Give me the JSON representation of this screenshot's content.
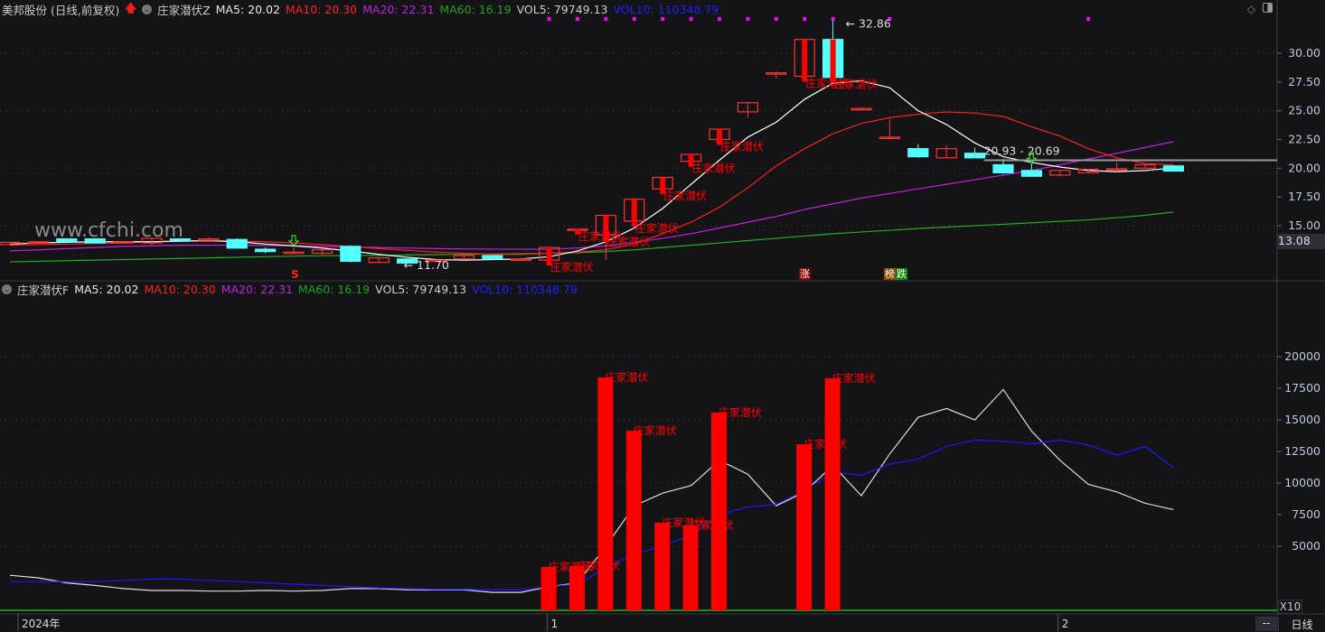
{
  "header": {
    "stock": "美邦股份 (日线,前复权)",
    "indicator": "庄家潜伏Z",
    "ma5": "MA5: 20.02",
    "ma10": "MA10: 20.30",
    "ma20": "MA20: 22.31",
    "ma60": "MA60: 16.19",
    "vol5": "VOL5: 79749.13",
    "vol10": "VOL10: 110348.79"
  },
  "header2": {
    "indicator": "庄家潜伏F",
    "ma5": "MA5: 20.02",
    "ma10": "MA10: 20.30",
    "ma20": "MA20: 22.31",
    "ma60": "MA60: 16.19",
    "vol5": "VOL5: 79749.13",
    "vol10": "VOL10: 110348.79"
  },
  "watermark": "www.cfchi.com",
  "current_price": "13.08",
  "scale_label": "X10",
  "period_label": "日线",
  "dash_label": "--",
  "badges": {
    "rise": "涨",
    "list": "榜",
    "fall": "跌"
  },
  "colors": {
    "up": "#ff3232",
    "down": "#54ffff",
    "signal": "#ff0000",
    "ma5": "#ffffff",
    "ma10": "#ff2020",
    "ma20": "#c020e0",
    "ma60": "#20b020",
    "vol_ma5": "#dddddd",
    "vol_ma10": "#1a1aff",
    "marker": "#ff00ff"
  },
  "chart_data": [
    {
      "type": "candlestick",
      "price_axis": {
        "ticks": [
          "30.00",
          "27.50",
          "25.00",
          "22.50",
          "20.00",
          "17.50",
          "15.00"
        ],
        "range": [
          11.0,
          33.0
        ],
        "grid": [
          30,
          25,
          20,
          15
        ]
      },
      "x_labels": [
        {
          "index": 0,
          "label": "2024年"
        },
        {
          "index": 19,
          "label": "1"
        },
        {
          "index": 37,
          "label": "2"
        }
      ],
      "ohlc": [
        [
          13.35,
          13.6,
          13.25,
          13.55
        ],
        [
          13.6,
          13.65,
          13.55,
          13.6
        ],
        [
          13.85,
          13.9,
          13.55,
          13.6
        ],
        [
          13.85,
          13.9,
          13.45,
          13.5
        ],
        [
          13.6,
          13.65,
          13.55,
          13.6
        ],
        [
          13.5,
          13.95,
          13.3,
          13.9
        ],
        [
          13.85,
          13.9,
          13.65,
          13.7
        ],
        [
          13.75,
          14.0,
          13.7,
          13.85
        ],
        [
          13.8,
          13.9,
          13.0,
          13.05
        ],
        [
          12.95,
          13.1,
          12.6,
          12.75
        ],
        [
          12.7,
          13.2,
          12.55,
          12.7
        ],
        [
          12.6,
          12.95,
          12.45,
          12.9
        ],
        [
          13.2,
          13.3,
          11.8,
          11.9
        ],
        [
          11.8,
          12.25,
          11.75,
          12.2
        ],
        [
          12.1,
          12.15,
          11.7,
          11.75
        ],
        [
          12.0,
          12.05,
          11.95,
          12.0
        ],
        [
          12.1,
          12.45,
          12.0,
          12.4
        ],
        [
          12.4,
          12.45,
          12.05,
          12.1
        ],
        [
          12.1,
          12.2,
          12.0,
          12.1
        ],
        [
          12.0,
          13.1,
          11.9,
          13.1
        ],
        [
          14.7,
          14.75,
          14.65,
          14.7
        ],
        [
          14.2,
          15.9,
          12.0,
          15.9
        ],
        [
          15.4,
          17.4,
          15.3,
          17.3
        ],
        [
          18.2,
          19.3,
          18.1,
          19.2
        ],
        [
          20.6,
          21.2,
          20.5,
          21.2
        ],
        [
          22.5,
          23.4,
          22.4,
          23.4
        ],
        [
          24.9,
          25.7,
          24.4,
          25.7
        ],
        [
          28.3,
          28.4,
          27.8,
          28.3
        ],
        [
          28.0,
          31.2,
          27.9,
          31.2
        ],
        [
          31.2,
          32.86,
          27.9,
          27.9
        ],
        [
          25.2,
          25.3,
          25.1,
          25.2
        ],
        [
          22.7,
          24.3,
          22.6,
          22.7
        ],
        [
          21.7,
          22.1,
          20.9,
          21.0
        ],
        [
          20.9,
          22.0,
          20.85,
          21.7
        ],
        [
          21.3,
          21.8,
          20.9,
          20.9
        ],
        [
          20.3,
          20.8,
          19.5,
          19.6
        ],
        [
          19.8,
          20.4,
          19.3,
          19.3
        ],
        [
          19.4,
          19.8,
          19.3,
          19.8
        ],
        [
          19.6,
          19.9,
          19.55,
          19.9
        ],
        [
          19.9,
          20.5,
          19.85,
          19.95
        ],
        [
          20.0,
          20.3,
          19.95,
          20.3
        ],
        [
          20.2,
          20.25,
          19.7,
          19.75
        ]
      ],
      "ma5": [
        13.4,
        13.5,
        13.55,
        13.6,
        13.6,
        13.6,
        13.65,
        13.7,
        13.6,
        13.4,
        13.25,
        13.05,
        12.8,
        12.5,
        12.25,
        12.05,
        12.0,
        12.05,
        12.1,
        12.3,
        12.8,
        13.6,
        14.8,
        16.5,
        18.6,
        20.7,
        22.7,
        24.0,
        26.0,
        27.4,
        27.6,
        27.0,
        25.0,
        23.8,
        22.2,
        21.0,
        20.5,
        20.1,
        19.8,
        19.7,
        19.8,
        20.02
      ],
      "ma10": [
        13.3,
        13.35,
        13.4,
        13.45,
        13.5,
        13.6,
        13.65,
        13.7,
        13.65,
        13.6,
        13.5,
        13.35,
        13.2,
        13.0,
        12.85,
        12.7,
        12.6,
        12.5,
        12.5,
        12.6,
        12.7,
        12.9,
        13.4,
        14.3,
        15.3,
        16.6,
        18.3,
        20.2,
        21.7,
        23.0,
        23.9,
        24.4,
        24.7,
        24.9,
        24.8,
        24.5,
        23.6,
        22.8,
        21.7,
        20.9,
        20.4,
        20.3
      ],
      "ma20": [
        12.8,
        12.9,
        13.0,
        13.1,
        13.2,
        13.25,
        13.3,
        13.3,
        13.3,
        13.28,
        13.25,
        13.2,
        13.15,
        13.1,
        13.05,
        13.0,
        12.98,
        12.96,
        12.95,
        12.95,
        13.05,
        13.25,
        13.55,
        13.9,
        14.3,
        14.8,
        15.3,
        15.8,
        16.4,
        16.9,
        17.4,
        17.8,
        18.2,
        18.6,
        19.0,
        19.4,
        19.8,
        20.3,
        20.8,
        21.3,
        21.8,
        22.31
      ],
      "ma60": [
        11.85,
        11.9,
        11.95,
        12.0,
        12.05,
        12.1,
        12.15,
        12.2,
        12.25,
        12.3,
        12.35,
        12.38,
        12.4,
        12.42,
        12.45,
        12.48,
        12.5,
        12.53,
        12.56,
        12.6,
        12.65,
        12.75,
        12.9,
        13.1,
        13.3,
        13.5,
        13.7,
        13.9,
        14.1,
        14.3,
        14.45,
        14.6,
        14.75,
        14.88,
        15.0,
        15.12,
        15.25,
        15.38,
        15.5,
        15.7,
        15.9,
        16.19
      ],
      "signal_days": [
        19,
        20,
        21,
        22,
        23,
        24,
        25,
        28,
        29
      ],
      "signal_label": "庄家潜伏",
      "top_markers": [
        19,
        20,
        21,
        22,
        23,
        24,
        25,
        26,
        27,
        28,
        29,
        31,
        38
      ],
      "high_annotation": {
        "index": 29,
        "label": "32.86"
      },
      "low_annotation": {
        "index": 14,
        "label": "11.70"
      },
      "range_annotation": {
        "index": 34,
        "label": "20.93 - 20.69",
        "price": 20.69
      },
      "s_marker": {
        "index": 10,
        "label": "S"
      },
      "buy_arrows": [
        10,
        36
      ]
    },
    {
      "type": "bar+line",
      "axis": {
        "ticks": [
          "20000",
          "17500",
          "15000",
          "12500",
          "10000",
          "7500",
          "5000"
        ],
        "range": [
          0,
          20000
        ],
        "grid": [
          20000,
          15000,
          10000,
          5000
        ],
        "multiplier": "X10"
      },
      "signal_volumes": [
        {
          "index": 19,
          "value": 3357
        },
        {
          "index": 20,
          "value": 3430
        },
        {
          "index": 21,
          "value": 18357
        },
        {
          "index": 22,
          "value": 14140
        },
        {
          "index": 23,
          "value": 6860
        },
        {
          "index": 24,
          "value": 6640
        },
        {
          "index": 25,
          "value": 15570
        },
        {
          "index": 28,
          "value": 13070
        },
        {
          "index": 29,
          "value": 18290
        }
      ],
      "vol_ma5": [
        2700,
        2500,
        2100,
        1900,
        1650,
        1500,
        1500,
        1450,
        1450,
        1500,
        1450,
        1500,
        1650,
        1650,
        1550,
        1550,
        1550,
        1350,
        1350,
        1800,
        2100,
        5000,
        8200,
        9200,
        9800,
        11800,
        10700,
        8200,
        9300,
        11400,
        9000,
        12300,
        15200,
        15900,
        15000,
        17400,
        14100,
        11800,
        9900,
        9300,
        8400,
        7900
      ],
      "vol_ma10": [
        2200,
        2200,
        2200,
        2200,
        2300,
        2400,
        2400,
        2300,
        2200,
        2100,
        2000,
        1900,
        1800,
        1700,
        1650,
        1600,
        1600,
        1570,
        1560,
        1800,
        2000,
        3300,
        4400,
        5000,
        5900,
        7500,
        8100,
        8300,
        9400,
        10900,
        10600,
        11500,
        11900,
        12900,
        13400,
        13300,
        13100,
        13400,
        13000,
        12200,
        12900,
        11200
      ],
      "signal_label": "庄家潜伏"
    }
  ]
}
